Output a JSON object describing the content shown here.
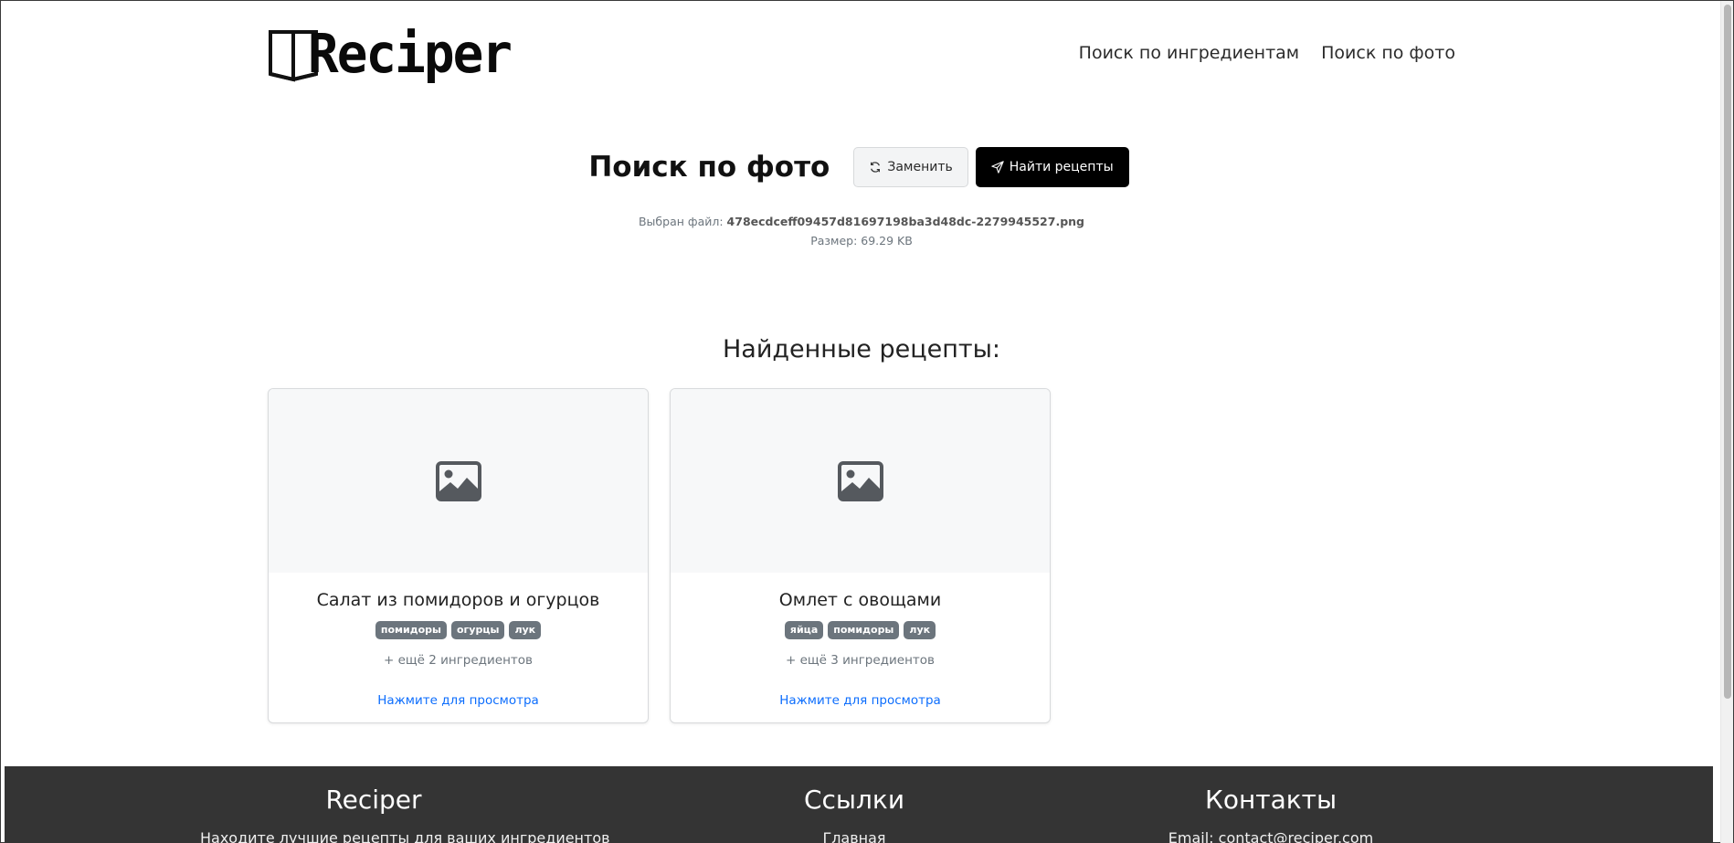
{
  "header": {
    "logo_text": "Reciper",
    "nav": [
      {
        "label": "Поиск по ингредиентам"
      },
      {
        "label": "Поиск по фото"
      }
    ]
  },
  "search": {
    "title": "Поиск по фото",
    "replace_label": "Заменить",
    "find_label": "Найти рецепты",
    "file_prefix": "Выбран файл:",
    "file_name": "478ecdceff09457d81697198ba3d48dc-2279945527.png",
    "size_text": "Размер: 69.29 KB"
  },
  "results": {
    "title": "Найденные рецепты:",
    "cards": [
      {
        "title": "Салат из помидоров и огурцов",
        "tags": [
          "помидоры",
          "огурцы",
          "лук"
        ],
        "more": "+ ещё 2 ингредиентов",
        "link": "Нажмите для просмотра"
      },
      {
        "title": "Омлет с овощами",
        "tags": [
          "яйца",
          "помидоры",
          "лук"
        ],
        "more": "+ ещё 3 ингредиентов",
        "link": "Нажмите для просмотра"
      }
    ]
  },
  "footer": {
    "brand_title": "Reciper",
    "brand_text": "Находите лучшие рецепты для ваших ингредиентов",
    "links_title": "Ссылки",
    "links_first": "Главная",
    "contacts_title": "Контакты",
    "contacts_email": "Email: contact@reciper.com"
  },
  "icons": {
    "logo": "open-book-icon",
    "replace": "refresh-icon",
    "find": "send-icon",
    "placeholder": "image-icon"
  }
}
